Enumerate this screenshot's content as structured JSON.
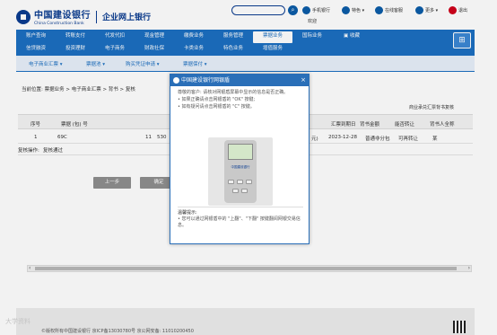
{
  "header": {
    "brand_cn": "中国建设银行",
    "brand_en": "China Construction Bank",
    "product": "企业网上银行",
    "welcome": "欢迎",
    "tools": [
      {
        "label": "手机银行",
        "icon": "phone-icon"
      },
      {
        "label": "特色 ▾",
        "icon": "star-icon"
      },
      {
        "label": "在线客服",
        "icon": "chat-icon"
      },
      {
        "label": "更多 ▾",
        "icon": "more-icon"
      },
      {
        "label": "退出",
        "icon": "power-icon"
      }
    ],
    "search_icon": "search-icon"
  },
  "nav": {
    "row1": [
      "账户查询",
      "转账支付",
      "代发代扣",
      "现金管理",
      "缴费业务",
      "服务管理",
      "票据业务",
      "国际业务",
      "收藏"
    ],
    "row2": [
      "信贷融资",
      "投资理财",
      "电子商务",
      "财政社保",
      "卡类业务",
      "特色业务",
      "增值服务"
    ],
    "active": "票据业务",
    "grid_icon": "grid-icon"
  },
  "subnav": {
    "items": [
      "电子商业汇票 ▾",
      "票据池 ▾",
      "购买凭证申请 ▾",
      "票据保付 ▾"
    ]
  },
  "breadcrumb": "当前位置: 票据业务 > 电子商业汇票 > 背书 > 复核",
  "section_title": "商业承兑汇票背书复核",
  "table": {
    "headers": [
      "序号",
      "票据 (包) 号",
      "汇票到期日",
      "背书金额",
      "能否转让",
      "背书人全称"
    ],
    "row": {
      "index": "1",
      "bill_no": "69C",
      "mid_a": "11",
      "mid_b": "530",
      "amount_hint": "元)",
      "due_date": "2023-12-28",
      "split": "普通非分包",
      "transferable": "可再转让",
      "endorser": "某"
    },
    "ops_label": "复核操作:",
    "ops_value": "复核通过"
  },
  "buttons": {
    "prev": "上一步",
    "confirm": "确定"
  },
  "modal": {
    "title": "中国建设银行网银盾",
    "close": "×",
    "body_intro": "尊敬的客户: 请核对网银盾屏幕中显示的信息是否正确。",
    "body_ok": "• 如果正确请点击网银盾的 \"OK\" 按键;",
    "body_cancel": "• 如有疑问请点击网银盾的 \"C\" 按键。",
    "device_brand": "中国建设银行",
    "hint_title": "温馨提示:",
    "hint_text": "• 您可以通过网银盾中的 \"上翻\"、\"下翻\" 按键翻阅网银交易信息。"
  },
  "footer": {
    "copyright": "©版权所有中国建设银行   京ICP备13030780号   京公网安备: 11010200450",
    "watermark": "大学资料"
  }
}
